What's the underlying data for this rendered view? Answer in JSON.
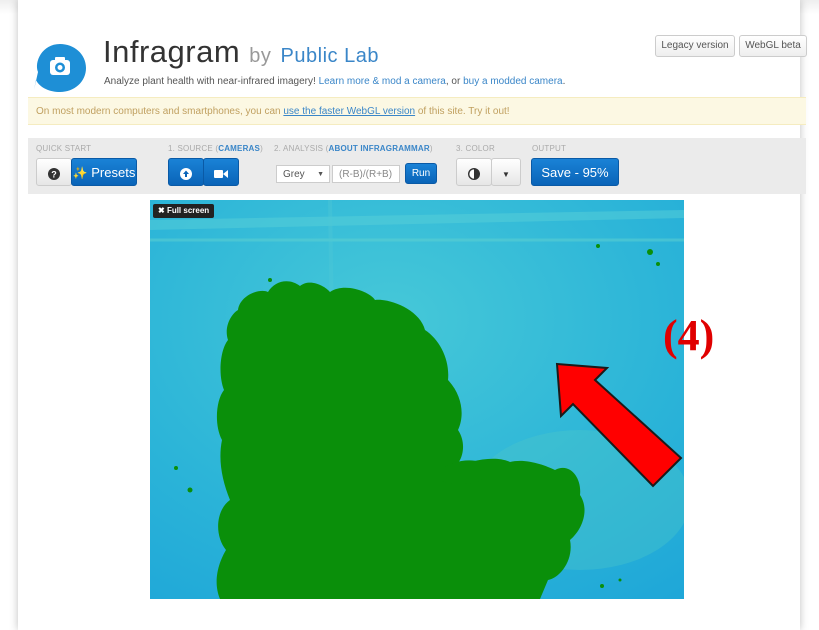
{
  "header": {
    "brand": "Infragram",
    "by": "by",
    "org": "Public Lab",
    "tagline_prefix": "Analyze plant health with near-infrared imagery!",
    "learn_link": "Learn more & mod a camera",
    "tagline_mid": ", or",
    "buy_link": "buy a modded camera",
    "tagline_end": "."
  },
  "top_buttons": {
    "legacy": "Legacy version",
    "webgl": "WebGL beta"
  },
  "alert": {
    "prefix": "On most modern computers and smartphones, you can",
    "link": "use the faster WebGL version",
    "suffix": "of this site. Try it out!"
  },
  "toolbar": {
    "quick_start_label": "QUICK START",
    "presets_label": "Presets",
    "source_label": "1. SOURCE (",
    "source_link": "CAMERAS",
    "source_close": ")",
    "analysis_label": "2. ANALYSIS (",
    "analysis_link": "ABOUT INFRAGRAMMAR",
    "analysis_close": ")",
    "mode_value": "Grey",
    "expression_placeholder": "(R-B)/(R+B)",
    "run_label": "Run",
    "color_label": "3. COLOR",
    "output_label": "OUTPUT",
    "save_label": "Save - 95%"
  },
  "viewer": {
    "fullscreen_label": "Full screen"
  },
  "annotation": {
    "label": "(4)",
    "arrow_color": "#ff0000"
  },
  "colors": {
    "primary": "#0a6cc2",
    "link": "#3a86c8",
    "image_bg": "#22aedb",
    "plant": "#0a8f0a"
  }
}
